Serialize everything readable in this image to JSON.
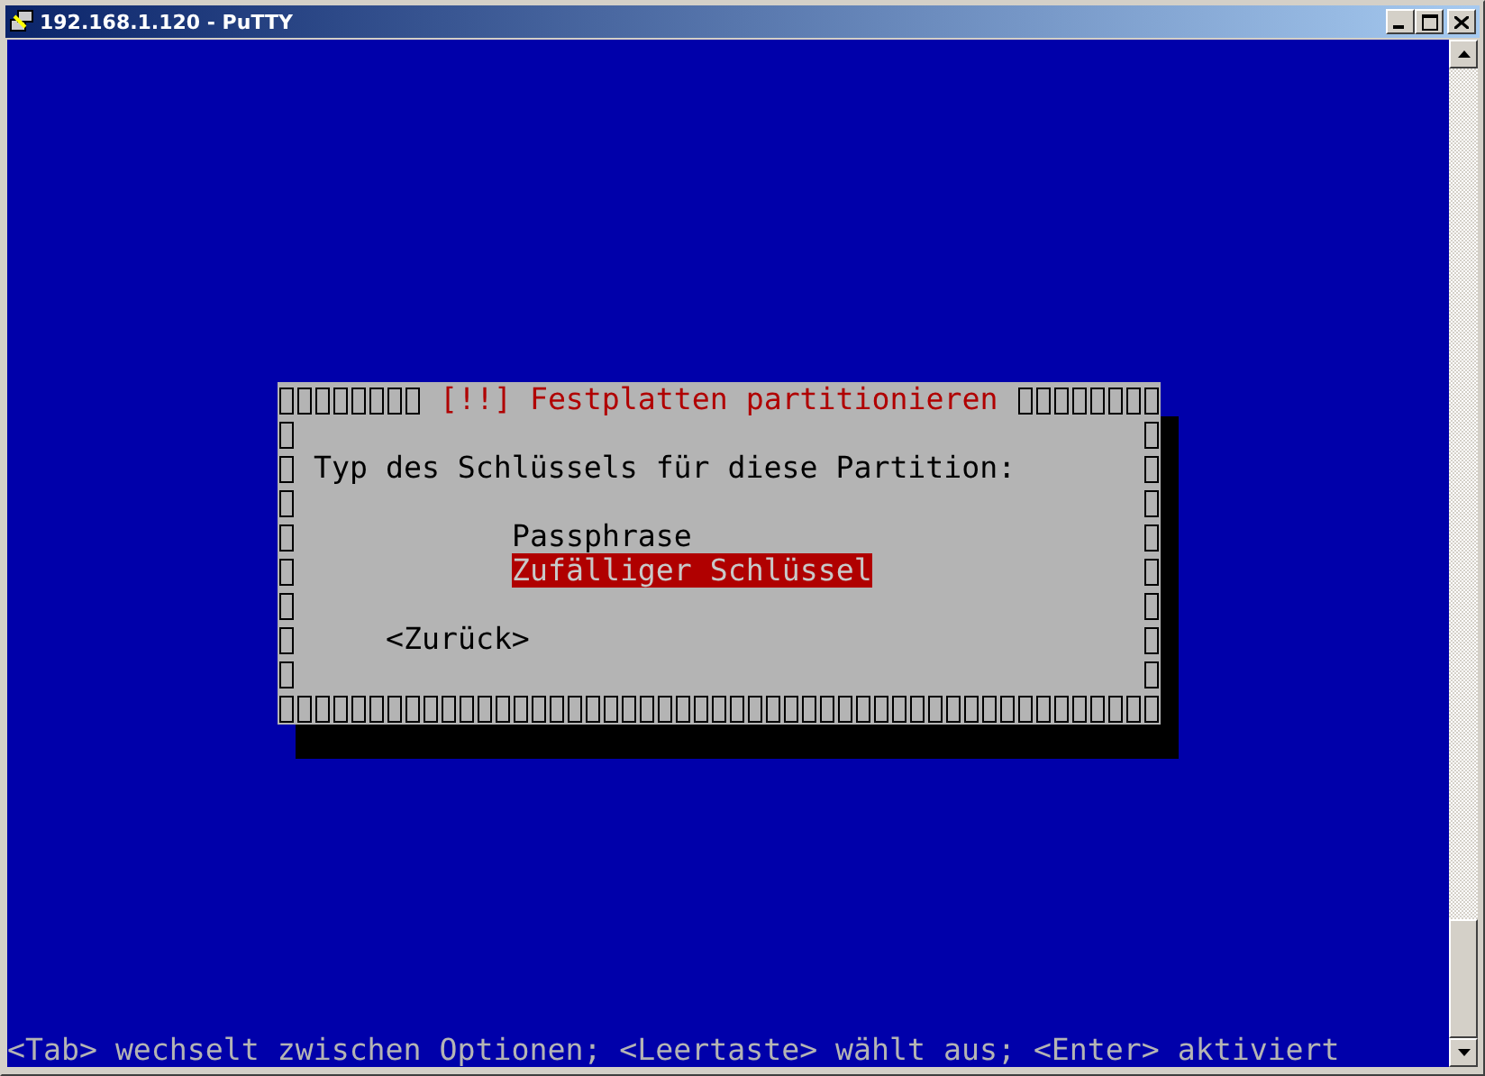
{
  "window": {
    "title": "192.168.1.120 - PuTTY"
  },
  "dialog": {
    "title": "[!!] Festplatten partitionieren",
    "prompt": "Typ des Schlüssels für diese Partition:",
    "options": [
      {
        "label": "Passphrase",
        "selected": false
      },
      {
        "label": "Zufälliger Schlüssel",
        "selected": true
      }
    ],
    "back_button": "<Zurück>"
  },
  "status_line": "<Tab> wechselt zwischen Optionen; <Leertaste> wählt aus; <Enter> aktiviert"
}
